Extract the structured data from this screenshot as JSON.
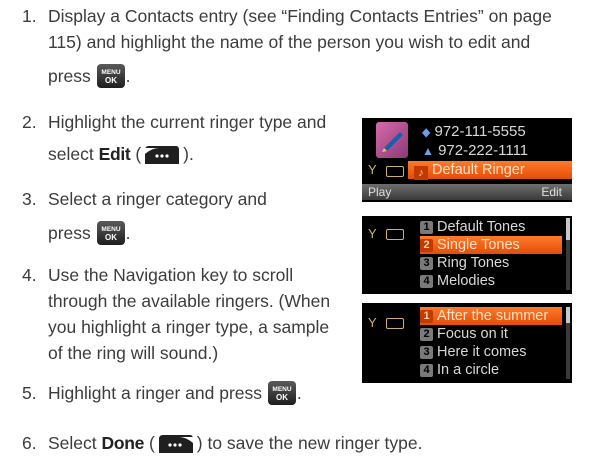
{
  "steps": [
    {
      "num": "1.",
      "lines": [
        "Display a Contacts entry (see “Finding Contacts Entries” on page",
        "115) and highlight the name of the person you wish to edit and",
        "press"
      ],
      "end": "."
    },
    {
      "num": "2.",
      "lines": [
        "Highlight the current ringer type and",
        "select"
      ],
      "keyword": "Edit",
      "open_paren": "(",
      "close": ")."
    },
    {
      "num": "3.",
      "lines": [
        "Select a ringer category and",
        "press"
      ],
      "end": "."
    },
    {
      "num": "4.",
      "lines": [
        "Use the Navigation key to scroll",
        "through the available ringers. (When",
        "you highlight a ringer type, a sample",
        "of the ring will sound.)"
      ]
    },
    {
      "num": "5.",
      "lines": [
        "Highlight a ringer and press"
      ],
      "end": "."
    },
    {
      "num": "6.",
      "lines": [
        "Select"
      ],
      "keyword": "Done",
      "open_paren": "(",
      "close": ") to save the new ringer type."
    }
  ],
  "menu_key": {
    "top": "MENU",
    "bottom": "OK"
  },
  "screen1": {
    "phone_1": "972-111-5555",
    "phone_2": "972-222-1111",
    "ringer": "Default Ringer",
    "soft_left": "Play",
    "soft_right": "Edit"
  },
  "screen2": {
    "items": [
      {
        "index": "1",
        "label": "Default Tones"
      },
      {
        "index": "2",
        "label": "Single Tones",
        "selected": true
      },
      {
        "index": "3",
        "label": "Ring Tones"
      },
      {
        "index": "4",
        "label": "Melodies"
      }
    ]
  },
  "screen3": {
    "items": [
      {
        "index": "1",
        "label": "After the summer",
        "selected": true
      },
      {
        "index": "2",
        "label": "Focus on it"
      },
      {
        "index": "3",
        "label": "Here it comes"
      },
      {
        "index": "4",
        "label": "In a circle"
      }
    ]
  },
  "colors": {
    "highlight": "#ff6a1a",
    "screen_bg": "#000000",
    "text": "#3c3c3c"
  }
}
